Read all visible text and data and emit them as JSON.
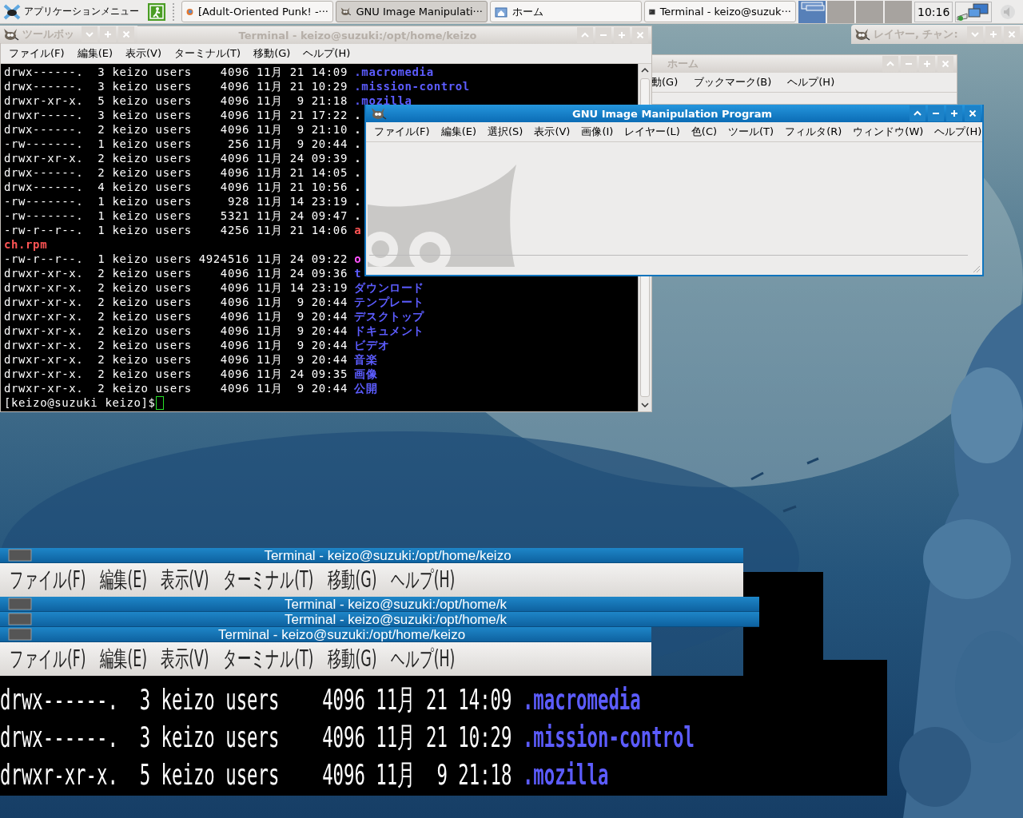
{
  "panel": {
    "app_menu": "アプリケーションメニュー",
    "tasks": [
      {
        "label": "[Adult-Oriented Punk! -···",
        "kind": "browser",
        "selected": false
      },
      {
        "label": "GNU Image Manipulati···",
        "kind": "gimp",
        "selected": true
      },
      {
        "label": "ホーム",
        "kind": "folder",
        "selected": false
      },
      {
        "label": "Terminal - keizo@suzuk···",
        "kind": "terminal",
        "selected": false
      }
    ],
    "workspaces": [
      {
        "selected": true
      },
      {
        "selected": false
      },
      {
        "selected": false
      },
      {
        "selected": false
      }
    ],
    "clock": "10:16"
  },
  "toolbox_window": {
    "title": "ツールボッ"
  },
  "layers_window": {
    "title": "レイヤー, チャン:"
  },
  "home_window": {
    "title": "ホーム",
    "menu": [
      "動(G)",
      "ブックマーク(B)",
      "ヘルプ(H)"
    ]
  },
  "terminal": {
    "title": "Terminal - keizo@suzuki:/opt/home/keizo",
    "menu": [
      "ファイル(F)",
      "編集(E)",
      "表示(V)",
      "ターミナル(T)",
      "移動(G)",
      "ヘルプ(H)"
    ],
    "rows": [
      {
        "text": "drwx------.  3 keizo users    4096 11月 21 14:09",
        "name": ".macromedia",
        "color": "#5c5cff"
      },
      {
        "text": "drwx------.  3 keizo users    4096 11月 21 10:29",
        "name": ".mission-control",
        "color": "#5c5cff"
      },
      {
        "text": "drwxr-xr-x.  5 keizo users    4096 11月  9 21:18",
        "name": ".mozilla",
        "color": "#5c5cff"
      },
      {
        "text": "drwxr-----.  3 keizo users    4096 11月 21 17:22",
        "name": "."
      },
      {
        "text": "drwx------.  2 keizo users    4096 11月  9 21:10",
        "name": "."
      },
      {
        "text": "-rw-------.  1 keizo users     256 11月  9 20:44",
        "name": "."
      },
      {
        "text": "drwxr-xr-x.  2 keizo users    4096 11月 24 09:39",
        "name": "."
      },
      {
        "text": "drwx------.  2 keizo users    4096 11月 21 14:05",
        "name": "."
      },
      {
        "text": "drwx------.  4 keizo users    4096 11月 21 10:56",
        "name": "."
      },
      {
        "text": "-rw-------.  1 keizo users     928 11月 14 23:19",
        "name": "."
      },
      {
        "text": "-rw-------.  1 keizo users    5321 11月 24 09:47",
        "name": "."
      },
      {
        "text": "-rw-r--r--.  1 keizo users    4256 11月 21 14:06",
        "name": "a",
        "color": "#ff5454"
      },
      {
        "name": "ch.rpm",
        "color": "#ff5454"
      },
      {
        "text": "-rw-r--r--.  1 keizo users 4924516 11月 24 09:22",
        "name": "o",
        "color": "#ff54ff"
      },
      {
        "text": "drwxr-xr-x.  2 keizo users    4096 11月 24 09:36",
        "name": "t",
        "color": "#5c5cff"
      },
      {
        "text": "drwxr-xr-x.  2 keizo users    4096 11月 14 23:19",
        "name": "ダウンロード",
        "color": "#5c5cff"
      },
      {
        "text": "drwxr-xr-x.  2 keizo users    4096 11月  9 20:44",
        "name": "テンプレート",
        "color": "#5c5cff"
      },
      {
        "text": "drwxr-xr-x.  2 keizo users    4096 11月  9 20:44",
        "name": "デスクトップ",
        "color": "#5c5cff"
      },
      {
        "text": "drwxr-xr-x.  2 keizo users    4096 11月  9 20:44",
        "name": "ドキュメント",
        "color": "#5c5cff"
      },
      {
        "text": "drwxr-xr-x.  2 keizo users    4096 11月  9 20:44",
        "name": "ビデオ",
        "color": "#5c5cff"
      },
      {
        "text": "drwxr-xr-x.  2 keizo users    4096 11月  9 20:44",
        "name": "音楽",
        "color": "#5c5cff"
      },
      {
        "text": "drwxr-xr-x.  2 keizo users    4096 11月 24 09:35",
        "name": "画像",
        "color": "#5c5cff"
      },
      {
        "text": "drwxr-xr-x.  2 keizo users    4096 11月  9 20:44",
        "name": "公開",
        "color": "#5c5cff"
      }
    ],
    "prompt": "[keizo@suzuki keizo]$"
  },
  "gimp": {
    "title": "GNU Image Manipulation Program",
    "menu": [
      "ファイル(F)",
      "編集(E)",
      "選択(S)",
      "表示(V)",
      "画像(I)",
      "レイヤー(L)",
      "色(C)",
      "ツール(T)",
      "フィルタ(R)",
      "ウィンドウ(W)",
      "ヘルプ(H)"
    ]
  },
  "ghost": [
    {
      "kind": "titlebar",
      "title": "Terminal - keizo@suzuki:/opt/home/keizo"
    },
    {
      "kind": "menubar",
      "menu": [
        "ファイル(F)",
        "編集(E)",
        "表示(V)",
        "ターミナル(T)",
        "移動(G)",
        "ヘルプ(H)"
      ]
    },
    {
      "kind": "titlebar",
      "title": "Terminal - keizo@suzuki:/opt/home/k"
    },
    {
      "kind": "titlebar",
      "title": "Terminal - keizo@suzuki:/opt/home/k"
    },
    {
      "kind": "titlebar",
      "title": "Terminal - keizo@suzuki:/opt/home/keizo"
    },
    {
      "kind": "menubar",
      "menu": [
        "ファイル(F)",
        "編集(E)",
        "表示(V)",
        "ターミナル(T)",
        "移動(G)",
        "ヘルプ(H)"
      ]
    },
    {
      "kind": "listing",
      "rows": [
        {
          "text": "drwx------.  3 keizo users    4096 11月 21 14:09",
          "name": ".macromedia",
          "color": "#5c5cff"
        },
        {
          "text": "drwx------.  3 keizo users    4096 11月 21 10:29",
          "name": ".mission-control",
          "color": "#5c5cff"
        },
        {
          "text": "drwxr-xr-x.  5 keizo users    4096 11月  9 21:18",
          "name": ".mozilla",
          "color": "#5c5cff"
        }
      ]
    }
  ]
}
